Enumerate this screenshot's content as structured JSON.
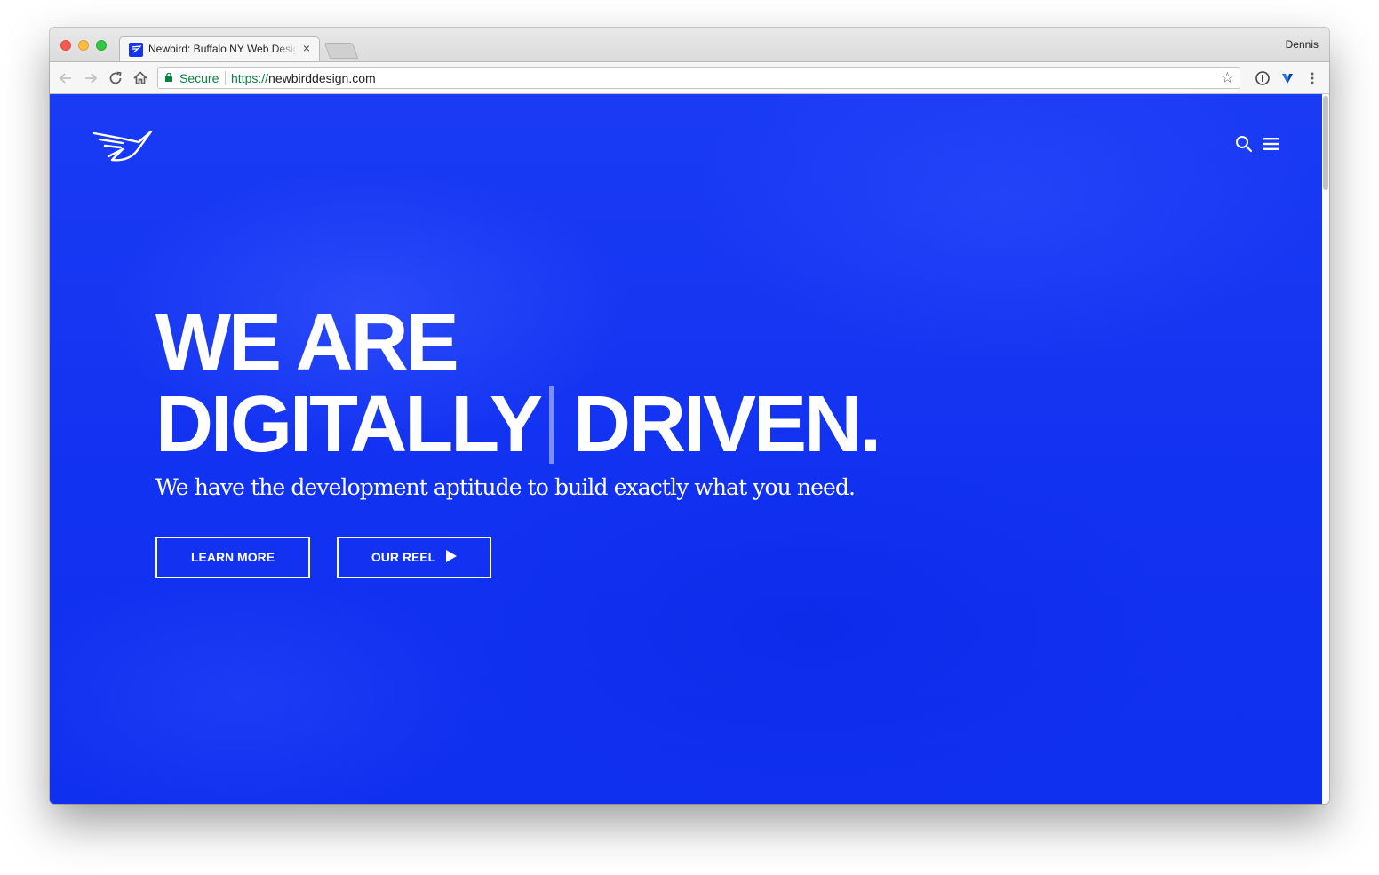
{
  "browser": {
    "tab": {
      "title": "Newbird: Buffalo NY Web Design",
      "close_glyph": "×"
    },
    "profile_name": "Dennis",
    "address_bar": {
      "security_label": "Secure",
      "url_scheme": "https://",
      "url_host": "newbirddesign.com"
    },
    "toolbar_icons": [
      "back-arrow-icon",
      "forward-arrow-icon",
      "reload-icon",
      "home-icon",
      "bookmark-star-icon",
      "password-manager-icon",
      "extension-icon",
      "more-menu-icon"
    ]
  },
  "site": {
    "brand_color": "#1333f1",
    "logo": "newbird-bird-logo",
    "header_icons": [
      "search-icon",
      "hamburger-menu-icon"
    ],
    "hero": {
      "headline_line1": "WE ARE",
      "headline_word1": "DIGITALLY",
      "headline_word2": "DRIVEN.",
      "subheadline": "We have the development aptitude to build exactly what you need.",
      "buttons": {
        "learn_more": "LEARN MORE",
        "our_reel": "OUR REEL"
      }
    }
  }
}
